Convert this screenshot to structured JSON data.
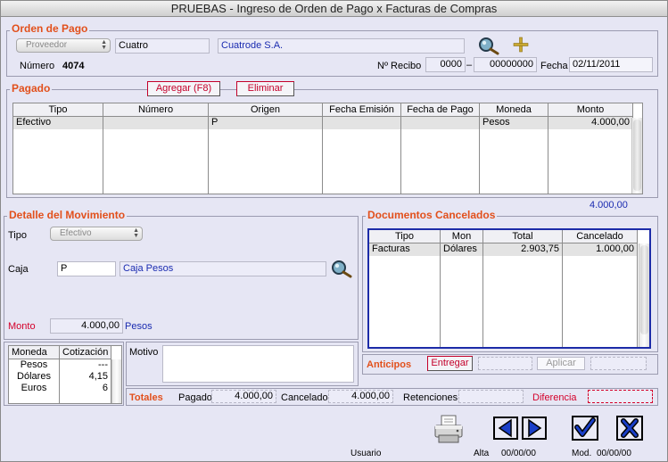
{
  "window": {
    "title": "PRUEBAS  - Ingreso de Orden de Pago x Facturas de Compras"
  },
  "orden": {
    "title": "Orden de Pago",
    "proveedor_popup": "Proveedor",
    "proveedor_code": "Cuatro",
    "proveedor_name": "Cuatrode S.A.",
    "numero_label": "Número",
    "numero_value": "4074",
    "recibo_label": "Nº Recibo",
    "recibo_serie": "0000",
    "recibo_dash": "–",
    "recibo_numero": "00000000",
    "fecha_label": "Fecha",
    "fecha_value": "02/11/2011"
  },
  "pagado": {
    "title": "Pagado",
    "agregar_label": "Agregar (F8)",
    "eliminar_label": "Eliminar",
    "columns": [
      "Tipo",
      "Número",
      "Origen",
      "Fecha Emisión",
      "Fecha de Pago",
      "Moneda",
      "Monto"
    ],
    "rows": [
      {
        "tipo": "Efectivo",
        "numero": "",
        "origen": "P",
        "emision": "",
        "pago": "",
        "moneda": "Pesos",
        "monto": "4.000,00"
      }
    ],
    "total": "4.000,00"
  },
  "detalle": {
    "title": "Detalle del Movimiento",
    "tipo_label": "Tipo",
    "tipo_popup": "Efectivo",
    "caja_label": "Caja",
    "caja_code": "P",
    "caja_name": "Caja Pesos",
    "monto_label": "Monto",
    "monto_value": "4.000,00",
    "monto_moneda": "Pesos"
  },
  "cotizacion": {
    "columns": [
      "Moneda",
      "Cotización"
    ],
    "rows": [
      {
        "moneda": "Pesos",
        "valor": "---"
      },
      {
        "moneda": "Dólares",
        "valor": "4,15"
      },
      {
        "moneda": "Euros",
        "valor": "6"
      }
    ]
  },
  "motivo": {
    "label": "Motivo",
    "value": ""
  },
  "documentos": {
    "title": "Documentos Cancelados",
    "columns": [
      "Tipo",
      "Mon",
      "Total",
      "Cancelado"
    ],
    "rows": [
      {
        "tipo": "Facturas",
        "mon": "Dólares",
        "total": "2.903,75",
        "cancelado": "1.000,00"
      }
    ]
  },
  "anticipos": {
    "label": "Anticipos",
    "entregar_label": "Entregar",
    "aplicar_label": "Aplicar"
  },
  "totales": {
    "label": "Totales",
    "pagado_label": "Pagado",
    "pagado_value": "4.000,00",
    "cancelado_label": "Cancelado",
    "cancelado_value": "4.000,00",
    "retenciones_label": "Retenciones",
    "retenciones_value": "",
    "diferencia_label": "Diferencia",
    "diferencia_value": ""
  },
  "footer": {
    "usuario_label": "Usuario",
    "alta_label": "Alta",
    "alta_value": "00/00/00",
    "mod_label": "Mod.",
    "mod_value": "00/00/00"
  },
  "icons": {
    "search": "magnifier-icon",
    "add": "plus-icon",
    "print": "printer-icon",
    "prev": "triangle-left-icon",
    "next": "triangle-right-icon",
    "ok": "checkmark-icon",
    "cancel": "x-icon"
  },
  "colors": {
    "accent": "#e2501c",
    "button_text": "#c4002a",
    "link_blue": "#1a2bb0",
    "nav_blue": "#1a3fc8",
    "background": "#e6e6f4"
  }
}
